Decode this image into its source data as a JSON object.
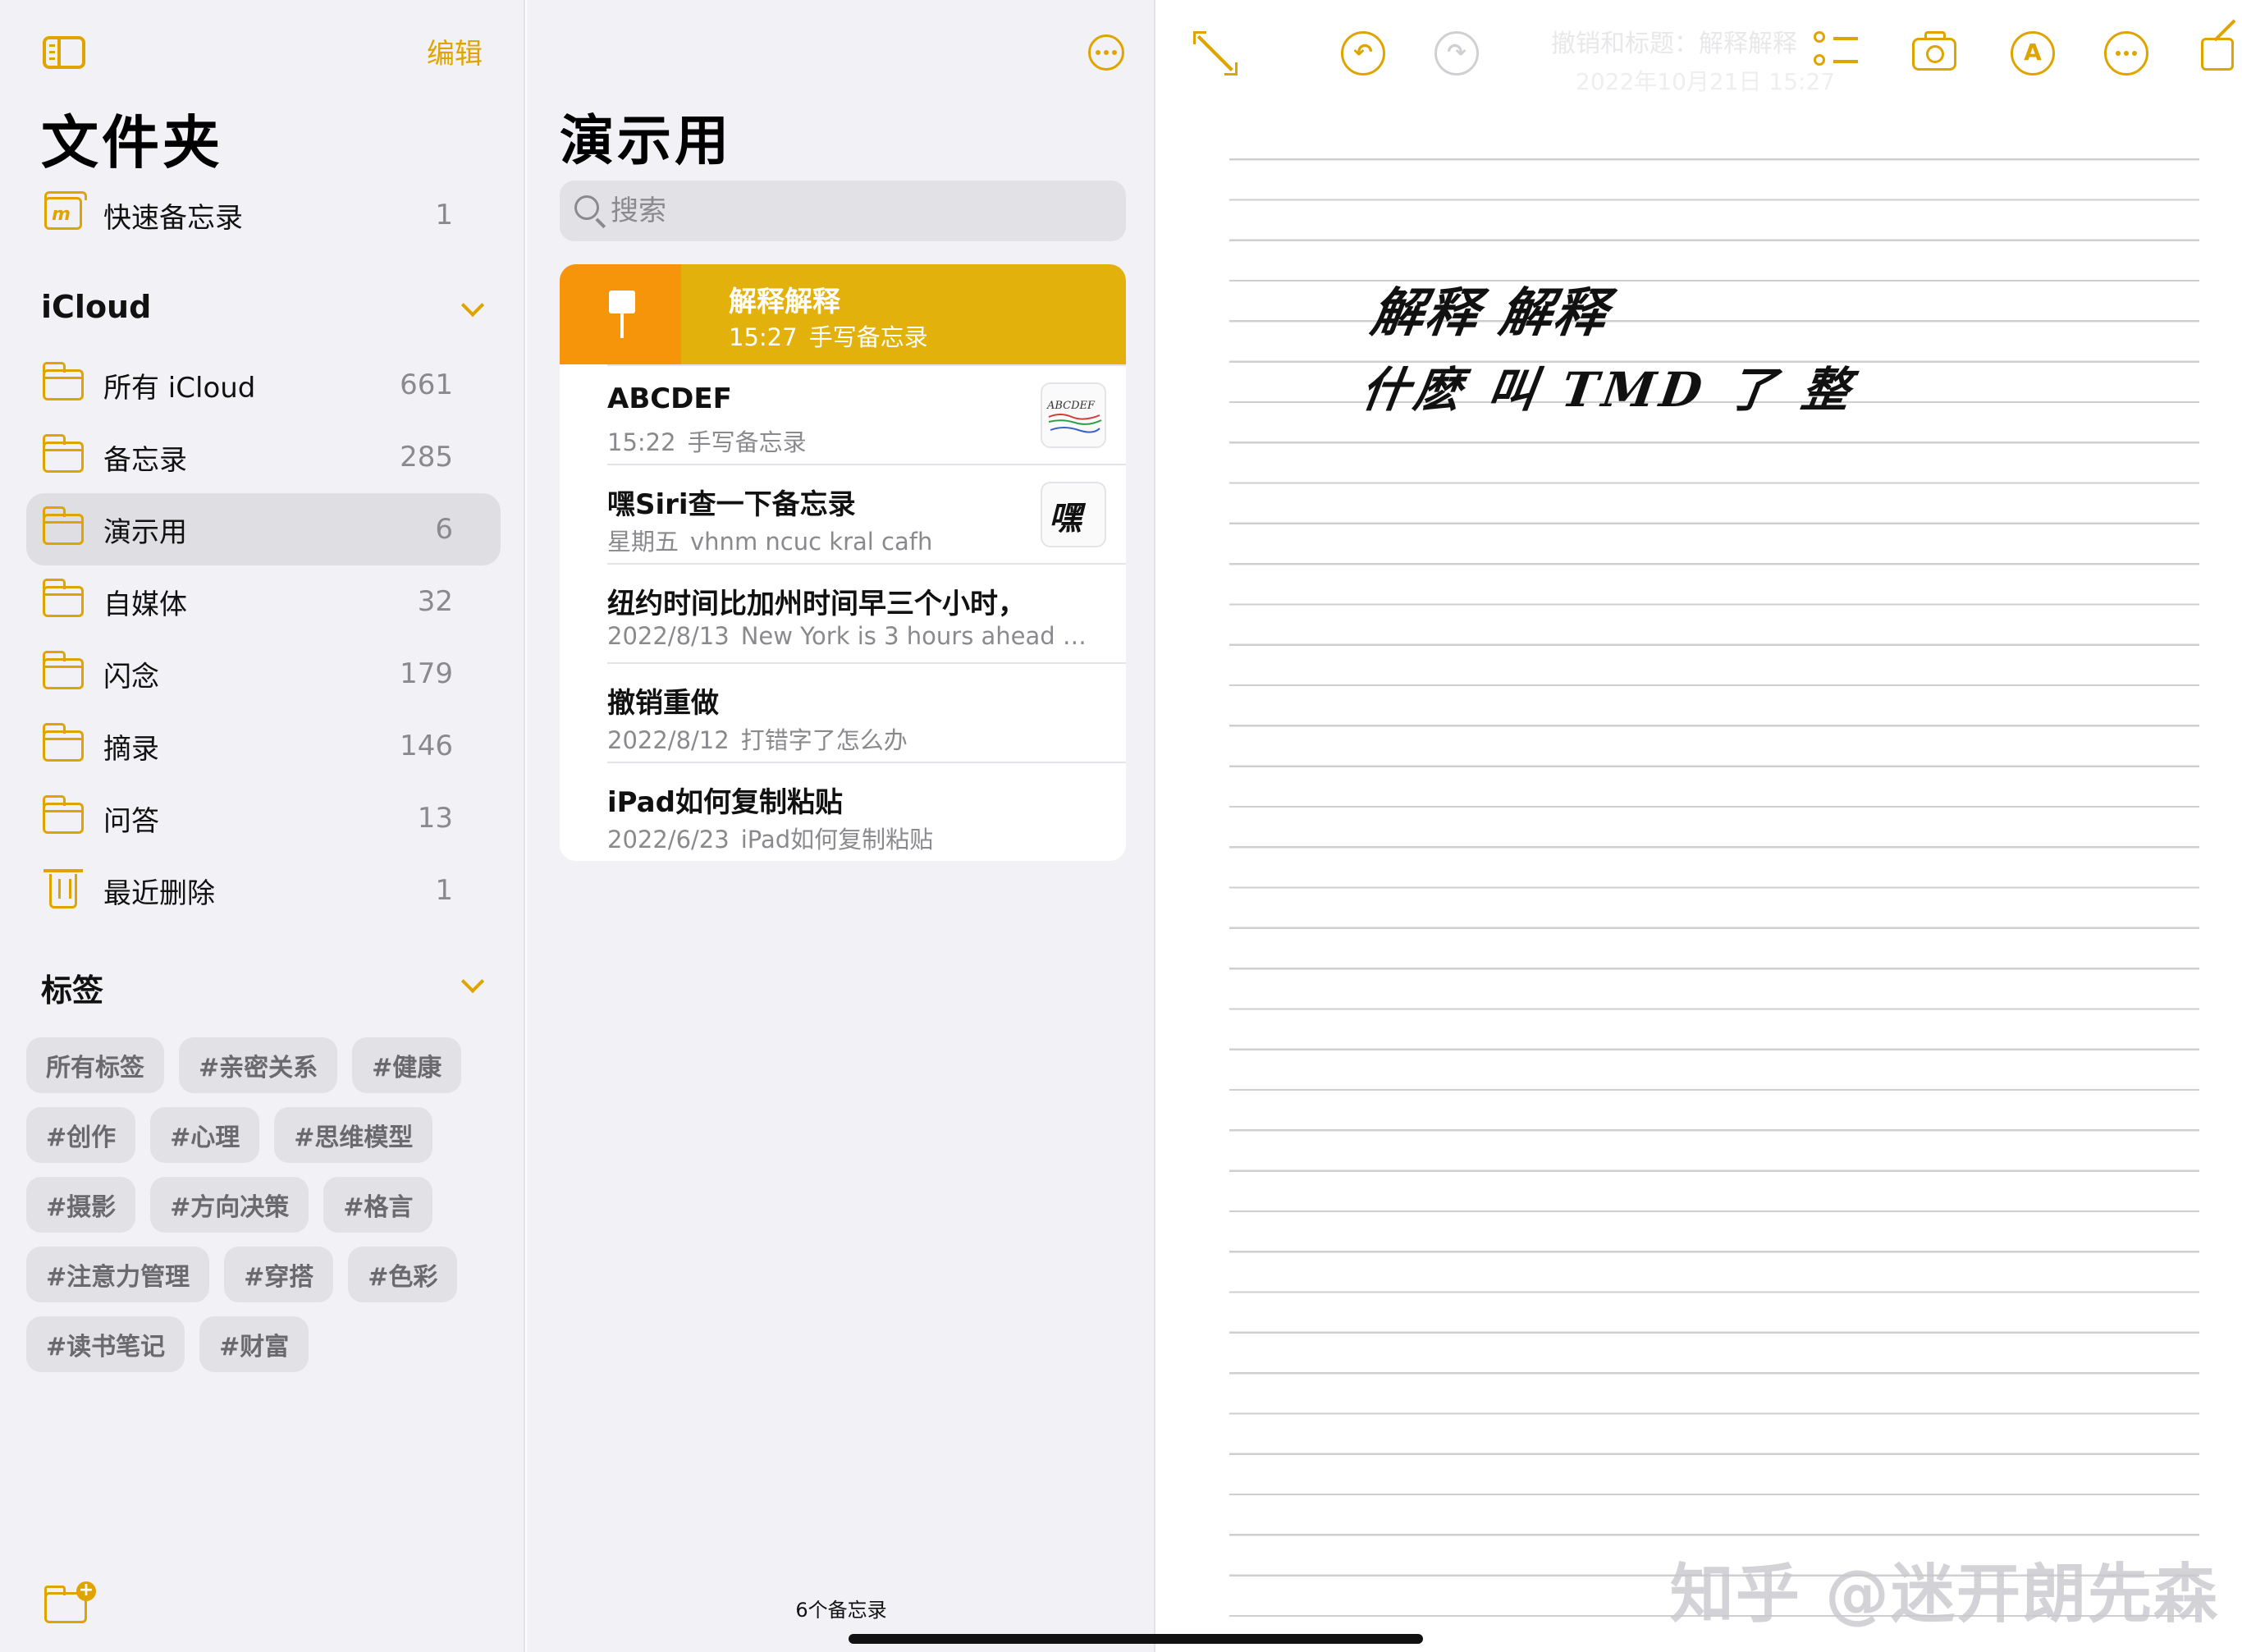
{
  "sidebar": {
    "edit_label": "编辑",
    "title": "文件夹",
    "quick_notes": {
      "label": "快速备忘录",
      "count": "1"
    },
    "icloud_header": "iCloud",
    "folders": [
      {
        "label": "所有 iCloud",
        "count": "661"
      },
      {
        "label": "备忘录",
        "count": "285"
      },
      {
        "label": "演示用",
        "count": "6",
        "selected": true
      },
      {
        "label": "自媒体",
        "count": "32"
      },
      {
        "label": "闪念",
        "count": "179"
      },
      {
        "label": "摘录",
        "count": "146"
      },
      {
        "label": "问答",
        "count": "13"
      }
    ],
    "recently_deleted": {
      "label": "最近删除",
      "count": "1"
    },
    "tags_header": "标签",
    "tags": [
      "所有标签",
      "#亲密关系",
      "#健康",
      "#创作",
      "#心理",
      "#思维模型",
      "#摄影",
      "#方向决策",
      "#格言",
      "#注意力管理",
      "#穿搭",
      "#色彩",
      "#读书笔记",
      "#财富"
    ]
  },
  "list": {
    "title": "演示用",
    "search_placeholder": "搜索",
    "notes": [
      {
        "title": "解释解释",
        "time": "15:27",
        "preview": "手写备忘录",
        "pinned": true
      },
      {
        "title": "ABCDEF",
        "time": "15:22",
        "preview": "手写备忘录",
        "thumb": "ABCDEF"
      },
      {
        "title": "嘿Siri查一下备忘录",
        "time": "星期五",
        "preview": "vhnm ncuc kral cafh",
        "thumb": "嘿"
      },
      {
        "title": "纽约时间比加州时间早三个小时，",
        "time": "2022/8/13",
        "preview": "New York is 3 hours ahead of..."
      },
      {
        "title": "撤销重做",
        "time": "2022/8/12",
        "preview": "打错字了怎么办"
      },
      {
        "title": "iPad如何复制粘贴",
        "time": "2022/6/23",
        "preview": "iPad如何复制粘贴"
      }
    ],
    "count_label": "6个备忘录"
  },
  "editor": {
    "ghost_title": "撤销和标题：解释解释",
    "ghost_date": "2022年10月21日 15:27",
    "handwriting": [
      "解释 解释",
      "什麽 叫 TMD 了 整"
    ],
    "watermark": "知乎 @迷开朗先森",
    "toolbar_icons": [
      "expand-icon",
      "undo-icon",
      "redo-icon",
      "checklist-icon",
      "camera-icon",
      "markup-icon",
      "more-icon",
      "compose-icon"
    ]
  },
  "colors": {
    "accent": "#e0a400",
    "pinned_bg": "#e2b10c",
    "pin_block": "#f7950a",
    "sidebar_bg": "#f2f2f6"
  }
}
